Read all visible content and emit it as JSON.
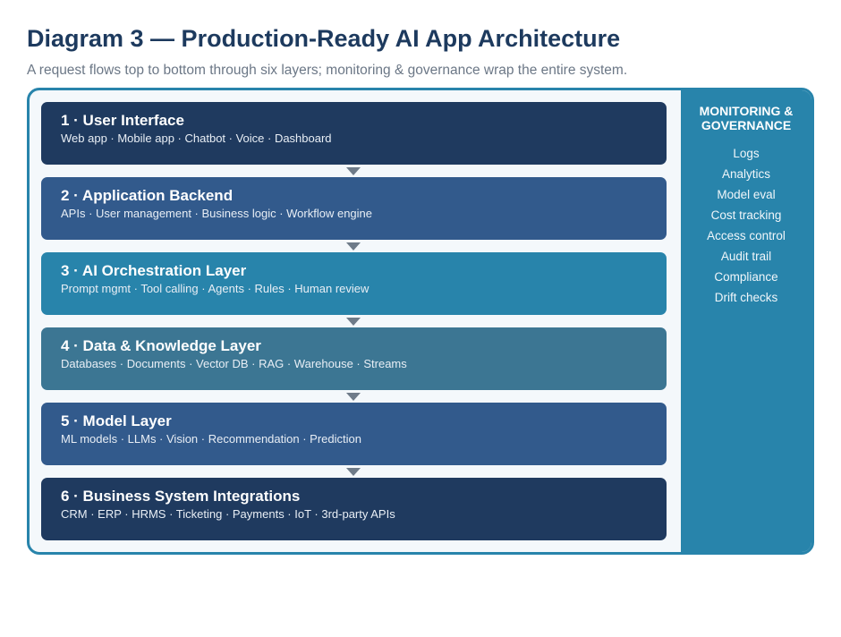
{
  "header": {
    "title": "Diagram 3 — Production-Ready AI App Architecture",
    "subtitle": "A request flows top to bottom through six layers; monitoring & governance wrap the entire system."
  },
  "layers": [
    {
      "title": "1 · User Interface",
      "items": "Web app · Mobile app · Chatbot · Voice · Dashboard",
      "color": "#1f3a5f"
    },
    {
      "title": "2 · Application Backend",
      "items": "APIs · User management · Business logic · Workflow engine",
      "color": "#325a8c"
    },
    {
      "title": "3 · AI Orchestration Layer",
      "items": "Prompt mgmt · Tool calling · Agents · Rules · Human review",
      "color": "#2884ab"
    },
    {
      "title": "4 · Data & Knowledge Layer",
      "items": "Databases · Documents · Vector DB · RAG · Warehouse · Streams",
      "color": "#3c7693"
    },
    {
      "title": "5 · Model Layer",
      "items": "ML models · LLMs · Vision · Recommendation · Prediction",
      "color": "#325a8c"
    },
    {
      "title": "6 · Business System Integrations",
      "items": "CRM · ERP · HRMS · Ticketing · Payments · IoT · 3rd-party APIs",
      "color": "#1f3a5f"
    }
  ],
  "sidebar": {
    "title": "MONITORING &\nGOVERNANCE",
    "items": [
      "Logs",
      "Analytics",
      "Model eval",
      "Cost tracking",
      "Access control",
      "Audit trail",
      "Compliance",
      "Drift checks"
    ],
    "color": "#2884ab"
  },
  "colors": {
    "title": "#1d3a5e",
    "subtitle": "#6b7786",
    "frame_border": "#2884ab",
    "frame_background": "#f4f8fb",
    "arrow": "#6e7b89"
  }
}
